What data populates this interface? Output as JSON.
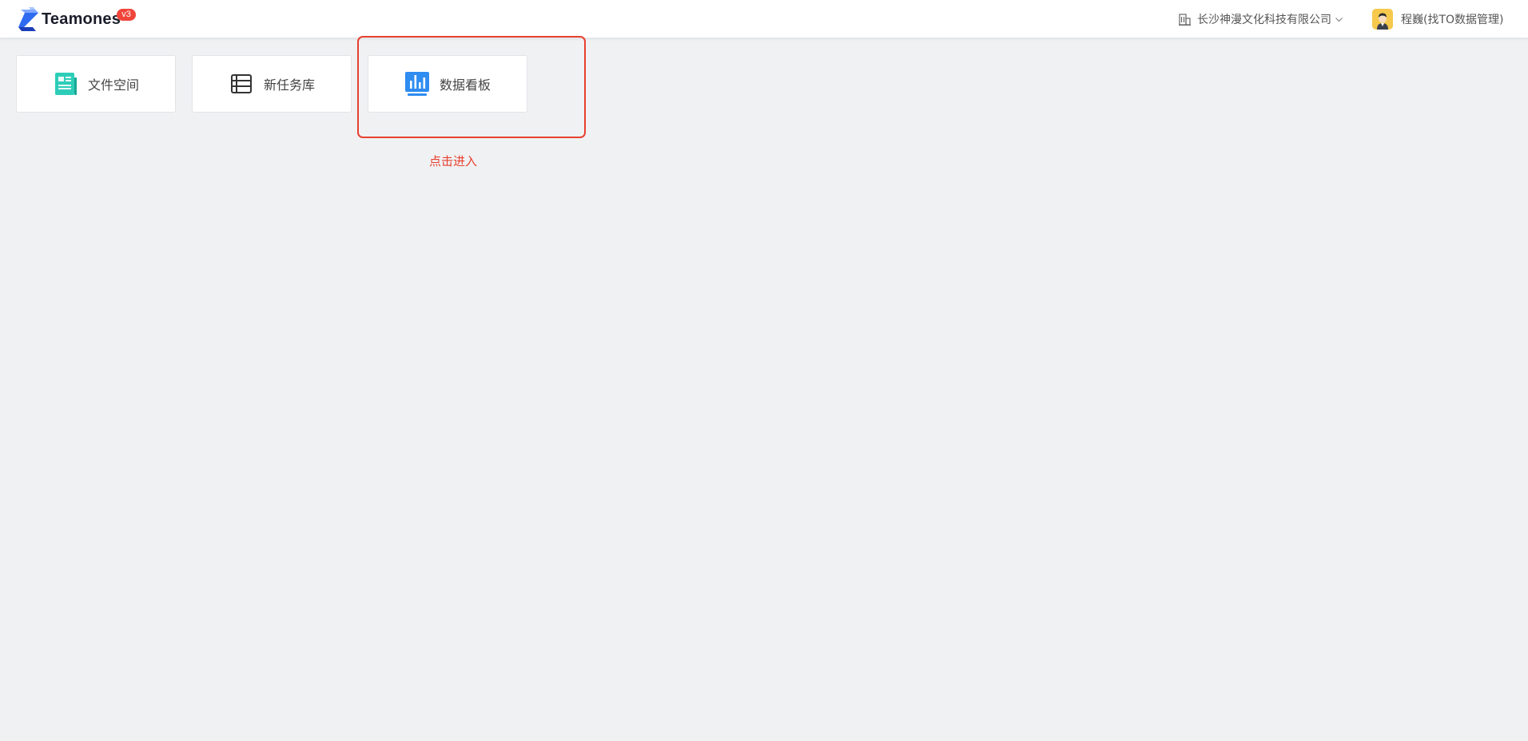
{
  "header": {
    "brand": "Teamones",
    "version_badge": "v3",
    "organization": "长沙神漫文化科技有限公司",
    "user_name": "程巍(找TO数据管理)"
  },
  "apps": [
    {
      "label": "文件空间",
      "icon": "file-space-icon"
    },
    {
      "label": "新任务库",
      "icon": "task-table-icon"
    },
    {
      "label": "数据看板",
      "icon": "data-dashboard-icon"
    }
  ],
  "annotation": {
    "text": "点击进入",
    "color": "#e8402f"
  },
  "colors": {
    "background": "#f0f1f3",
    "brand_blue": "#2f6bf1",
    "badge_red": "#f0453a",
    "teal_icon": "#2ecdb8",
    "dashboard_blue": "#2f8cf0"
  }
}
